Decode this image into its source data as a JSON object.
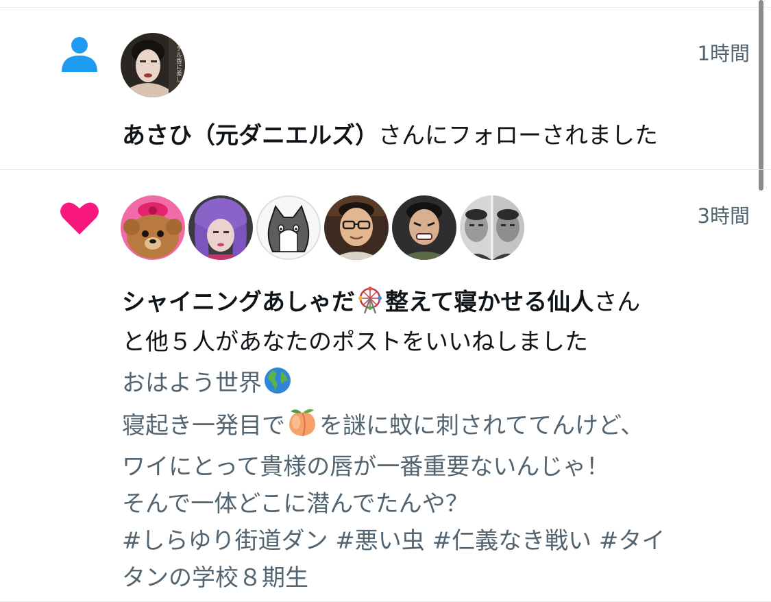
{
  "notifications": [
    {
      "type_icon": "person-icon",
      "time": "1時間",
      "avatars": [
        "avatar-portrait"
      ],
      "user_name": "あさひ（元ダニエルズ）",
      "message_suffix": "さんにフォローされました"
    },
    {
      "type_icon": "heart-icon",
      "time": "3時間",
      "avatars": [
        "avatar-teddy-bear",
        "avatar-purple-hair",
        "avatar-cat-drawing",
        "avatar-glasses-man",
        "avatar-grimace-man",
        "avatar-two-men"
      ],
      "user_name_1": "シャイニングあしゃだ",
      "name_emoji": "ferris-wheel-icon",
      "user_name_2": "整えて寝かせる仙人",
      "message_tail_1": "さん",
      "message_tail_2": "と他５人があなたのポストをいいねしました",
      "post": {
        "line1_text": "おはよう世界",
        "line1_emoji": "globe-icon",
        "line2_before": "寝起き一発目で",
        "line2_emoji": "peach-icon",
        "line2_after": "を謎に蚊に刺されててんけど、",
        "line3": "ワイにとって貴様の唇が一番重要ないんじゃ！",
        "line4": "そんで一体どこに潜んでたんや？",
        "line5": "#しらゆり街道ダン #悪い虫 #仁義なき戦い #タイ",
        "line6": "タンの学校８期生"
      }
    }
  ],
  "colors": {
    "follow_icon": "#1d9bf0",
    "like_icon": "#f91880",
    "primary_text": "#0f1419",
    "secondary_text": "#536471",
    "divider": "#e6e9ec"
  }
}
